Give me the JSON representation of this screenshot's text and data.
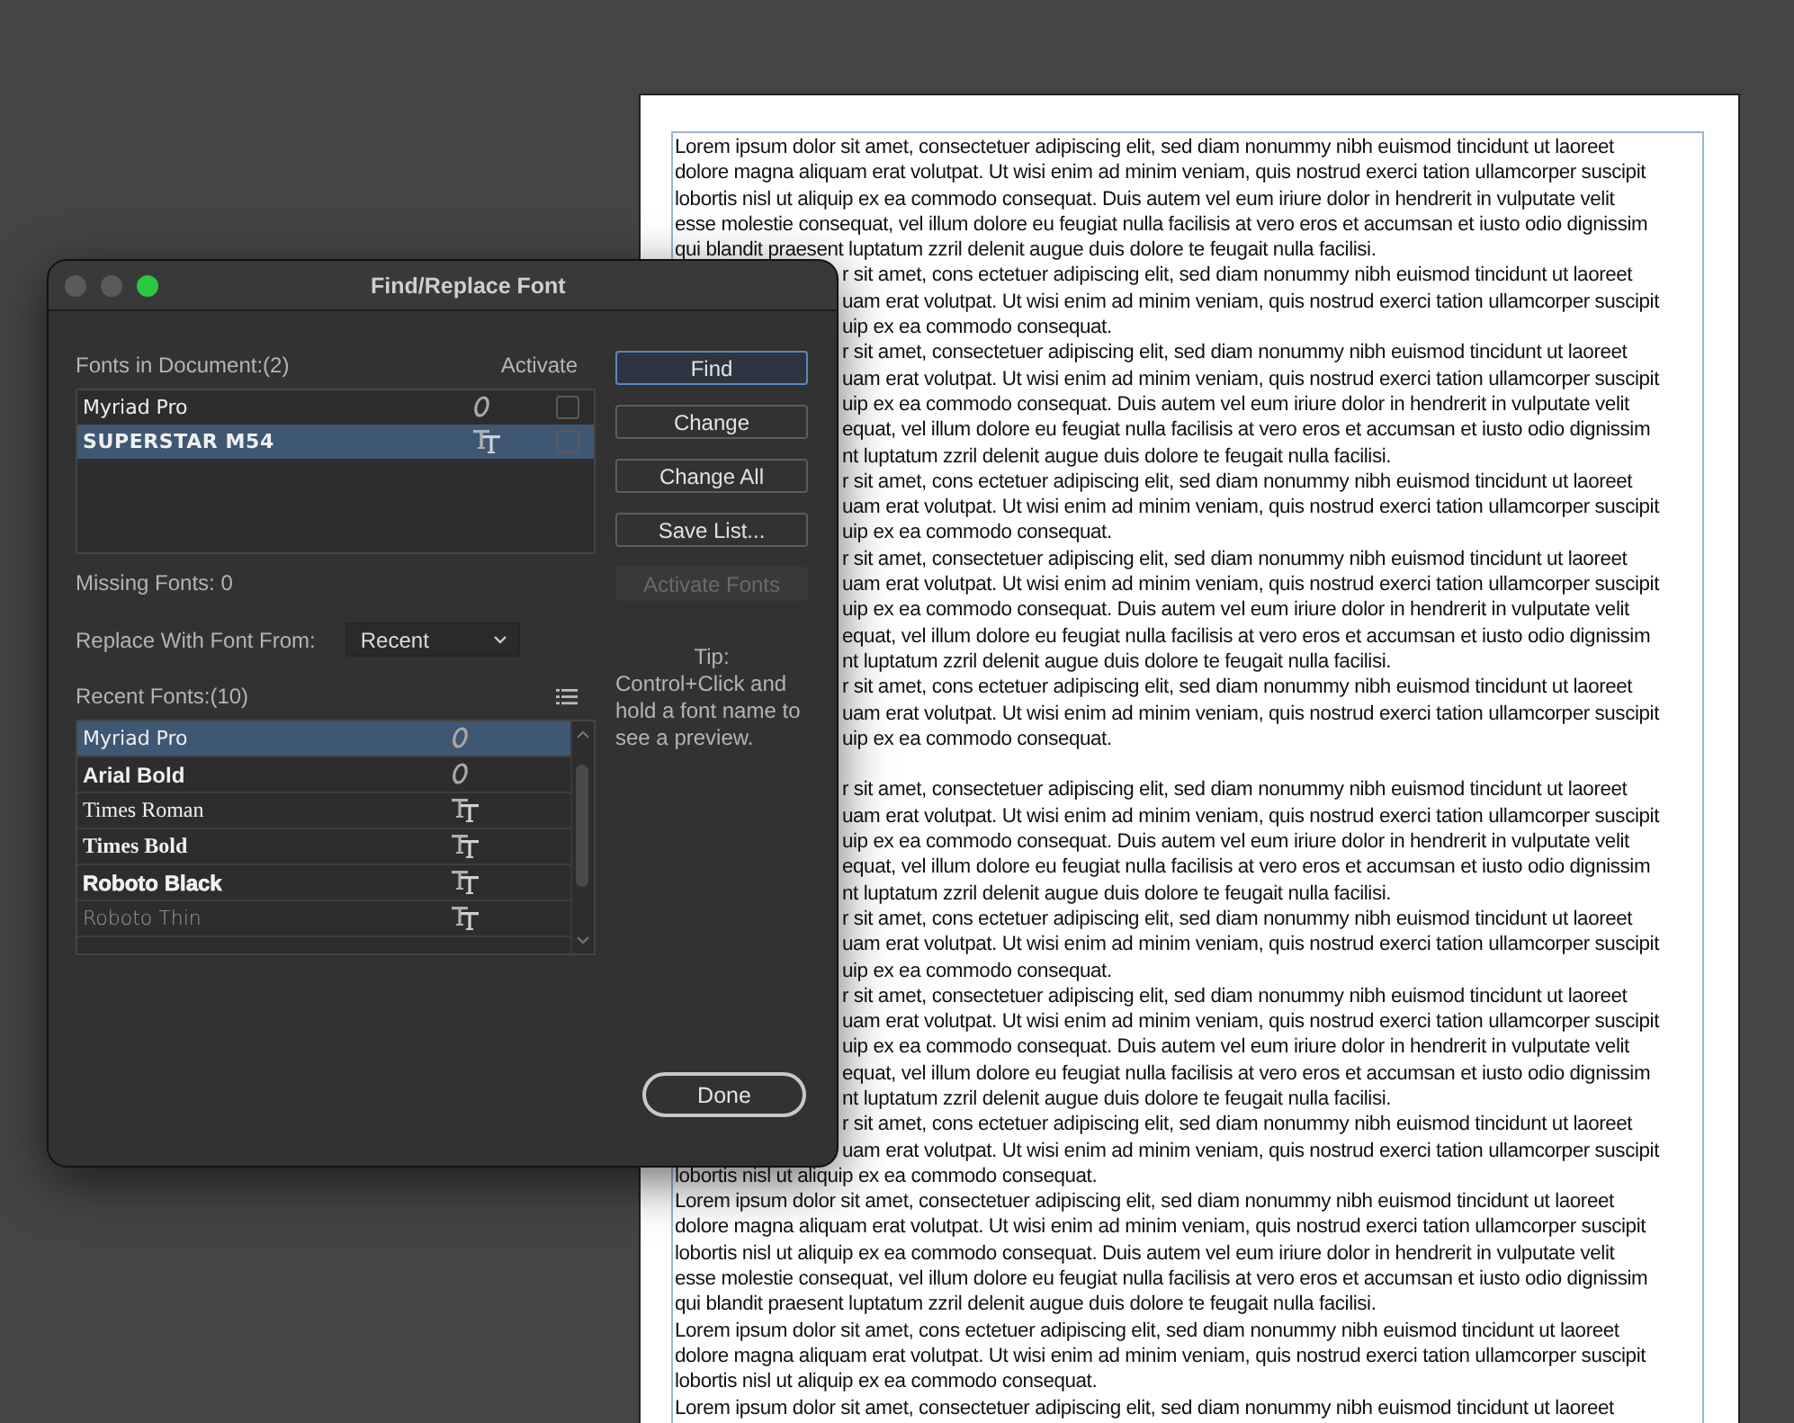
{
  "document": {
    "lines": [
      {
        "kind": "full",
        "text": "Lorem ipsum dolor sit amet, consectetuer adipiscing elit, sed diam nonummy nibh euismod tincidunt ut laoreet"
      },
      {
        "kind": "full",
        "text": "dolore magna aliquam erat volutpat. Ut wisi enim ad minim veniam, quis nostrud exerci tation ullamcorper suscipit"
      },
      {
        "kind": "full",
        "text": "lobortis nisl ut aliquip ex ea commodo consequat. Duis autem vel eum iriure dolor in hendrerit in vulputate velit"
      },
      {
        "kind": "full",
        "text": "esse molestie consequat, vel illum dolore eu feugiat nulla facilisis at vero eros et accumsan et iusto odio dignissim"
      },
      {
        "kind": "full",
        "text": "qui blandit praesent luptatum zzril delenit augue duis dolore te feugait nulla facilisi."
      },
      {
        "kind": "partial",
        "text": "r sit amet, cons ectetuer adipiscing elit, sed diam nonummy nibh euismod tincidunt ut laoreet"
      },
      {
        "kind": "partial",
        "text": "uam erat volutpat. Ut wisi enim ad minim veniam, quis nostrud exerci tation ullamcorper suscipit"
      },
      {
        "kind": "partial",
        "text": "uip ex ea commodo consequat."
      },
      {
        "kind": "partial",
        "text": "r sit amet, consectetuer adipiscing elit, sed diam nonummy nibh euismod tincidunt ut laoreet"
      },
      {
        "kind": "partial",
        "text": "uam erat volutpat. Ut wisi enim ad minim veniam, quis nostrud exerci tation ullamcorper suscipit"
      },
      {
        "kind": "partial",
        "text": "uip ex ea commodo consequat. Duis autem vel eum iriure dolor in hendrerit in vulputate velit"
      },
      {
        "kind": "partial",
        "text": "equat, vel illum dolore eu feugiat nulla facilisis at vero eros et accumsan et iusto odio dignissim"
      },
      {
        "kind": "partial",
        "text": "nt luptatum zzril delenit augue duis dolore te feugait nulla facilisi."
      },
      {
        "kind": "partial",
        "text": "r sit amet, cons ectetuer adipiscing elit, sed diam nonummy nibh euismod tincidunt ut laoreet"
      },
      {
        "kind": "partial",
        "text": "uam erat volutpat. Ut wisi enim ad minim veniam, quis nostrud exerci tation ullamcorper suscipit"
      },
      {
        "kind": "partial",
        "text": "uip ex ea commodo consequat."
      },
      {
        "kind": "partial",
        "text": "r sit amet, consectetuer adipiscing elit, sed diam nonummy nibh euismod tincidunt ut laoreet"
      },
      {
        "kind": "partial",
        "text": "uam erat volutpat. Ut wisi enim ad minim veniam, quis nostrud exerci tation ullamcorper suscipit"
      },
      {
        "kind": "partial",
        "text": "uip ex ea commodo consequat. Duis autem vel eum iriure dolor in hendrerit in vulputate velit"
      },
      {
        "kind": "partial",
        "text": "equat, vel illum dolore eu feugiat nulla facilisis at vero eros et accumsan et iusto odio dignissim"
      },
      {
        "kind": "partial",
        "text": "nt luptatum zzril delenit augue duis dolore te feugait nulla facilisi."
      },
      {
        "kind": "partial",
        "text": "r sit amet, cons ectetuer adipiscing elit, sed diam nonummy nibh euismod tincidunt ut laoreet"
      },
      {
        "kind": "partial",
        "text": "uam erat volutpat. Ut wisi enim ad minim veniam, quis nostrud exerci tation ullamcorper suscipit"
      },
      {
        "kind": "partial",
        "text": "uip ex ea commodo consequat."
      },
      {
        "kind": "gap"
      },
      {
        "kind": "partial",
        "text": "r sit amet, consectetuer adipiscing elit, sed diam nonummy nibh euismod tincidunt ut laoreet"
      },
      {
        "kind": "partial",
        "text": "uam erat volutpat. Ut wisi enim ad minim veniam, quis nostrud exerci tation ullamcorper suscipit"
      },
      {
        "kind": "partial",
        "text": "uip ex ea commodo consequat. Duis autem vel eum iriure dolor in hendrerit in vulputate velit"
      },
      {
        "kind": "partial",
        "text": "equat, vel illum dolore eu feugiat nulla facilisis at vero eros et accumsan et iusto odio dignissim"
      },
      {
        "kind": "partial",
        "text": "nt luptatum zzril delenit augue duis dolore te feugait nulla facilisi."
      },
      {
        "kind": "partial",
        "text": "r sit amet, cons ectetuer adipiscing elit, sed diam nonummy nibh euismod tincidunt ut laoreet"
      },
      {
        "kind": "partial",
        "text": "uam erat volutpat. Ut wisi enim ad minim veniam, quis nostrud exerci tation ullamcorper suscipit"
      },
      {
        "kind": "partial",
        "text": "uip ex ea commodo consequat."
      },
      {
        "kind": "partial",
        "text": "r sit amet, consectetuer adipiscing elit, sed diam nonummy nibh euismod tincidunt ut laoreet"
      },
      {
        "kind": "partial",
        "text": "uam erat volutpat. Ut wisi enim ad minim veniam, quis nostrud exerci tation ullamcorper suscipit"
      },
      {
        "kind": "partial",
        "text": "uip ex ea commodo consequat. Duis autem vel eum iriure dolor in hendrerit in vulputate velit"
      },
      {
        "kind": "partial",
        "text": "equat, vel illum dolore eu feugiat nulla facilisis at vero eros et accumsan et iusto odio dignissim"
      },
      {
        "kind": "partial",
        "text": "nt luptatum zzril delenit augue duis dolore te feugait nulla facilisi."
      },
      {
        "kind": "partial",
        "text": "r sit amet, cons ectetuer adipiscing elit, sed diam nonummy nibh euismod tincidunt ut laoreet"
      },
      {
        "kind": "partial",
        "text": "uam erat volutpat. Ut wisi enim ad minim veniam, quis nostrud exerci tation ullamcorper suscipit"
      },
      {
        "kind": "full",
        "text": "lobortis nisl ut aliquip ex ea commodo consequat."
      },
      {
        "kind": "full",
        "text": "Lorem ipsum dolor sit amet, consectetuer adipiscing elit, sed diam nonummy nibh euismod tincidunt ut laoreet"
      },
      {
        "kind": "full",
        "text": "dolore magna aliquam erat volutpat. Ut wisi enim ad minim veniam, quis nostrud exerci tation ullamcorper suscipit"
      },
      {
        "kind": "full",
        "text": "lobortis nisl ut aliquip ex ea commodo consequat. Duis autem vel eum iriure dolor in hendrerit in vulputate velit"
      },
      {
        "kind": "full",
        "text": "esse molestie consequat, vel illum dolore eu feugiat nulla facilisis at vero eros et accumsan et iusto odio dignissim"
      },
      {
        "kind": "full",
        "text": "qui blandit praesent luptatum zzril delenit augue duis dolore te feugait nulla facilisi."
      },
      {
        "kind": "full",
        "text": "Lorem ipsum dolor sit amet, cons ectetuer adipiscing elit, sed diam nonummy nibh euismod tincidunt ut laoreet"
      },
      {
        "kind": "full",
        "text": "dolore magna aliquam erat volutpat. Ut wisi enim ad minim veniam, quis nostrud exerci tation ullamcorper suscipit"
      },
      {
        "kind": "full",
        "text": "lobortis nisl ut aliquip ex ea commodo consequat."
      },
      {
        "kind": "full",
        "text": "Lorem ipsum dolor sit amet, consectetuer adipiscing elit, sed diam nonummy nibh euismod tincidunt ut laoreet"
      }
    ]
  },
  "dialog": {
    "title": "Find/Replace Font",
    "fonts_in_document": {
      "label": "Fonts in Document:(2)",
      "activate_label": "Activate",
      "items": [
        {
          "name": "Myriad Pro",
          "kind": "sans",
          "selected": false,
          "activate": false
        },
        {
          "name": "SUPERSTAR M54",
          "kind": "display",
          "selected": true,
          "activate": false
        }
      ]
    },
    "missing_fonts": "Missing Fonts: 0",
    "replace_from": {
      "label": "Replace With Font From:",
      "value": "Recent"
    },
    "recent_fonts": {
      "label": "Recent Fonts:(10)",
      "items": [
        {
          "name": "Myriad Pro",
          "kind": "sans",
          "selected": true
        },
        {
          "name": "Arial Bold",
          "kind": "bold",
          "selected": false
        },
        {
          "name": "Times Roman",
          "kind": "serif",
          "selected": false
        },
        {
          "name": "Times Bold",
          "kind": "serifbold",
          "selected": false
        },
        {
          "name": "Roboto Black",
          "kind": "black",
          "selected": false
        },
        {
          "name": "Roboto Thin",
          "kind": "thin",
          "selected": false
        }
      ]
    },
    "buttons": [
      {
        "label": "Find",
        "focused": true,
        "disabled": false
      },
      {
        "label": "Change",
        "focused": false,
        "disabled": false
      },
      {
        "label": "Change All",
        "focused": false,
        "disabled": false
      },
      {
        "label": "Save List...",
        "focused": false,
        "disabled": false
      },
      {
        "label": "Activate Fonts",
        "focused": false,
        "disabled": true
      }
    ],
    "tip_title": "Tip:",
    "tip_text": "Control+Click and hold a font name to see a preview.",
    "done": "Done"
  }
}
